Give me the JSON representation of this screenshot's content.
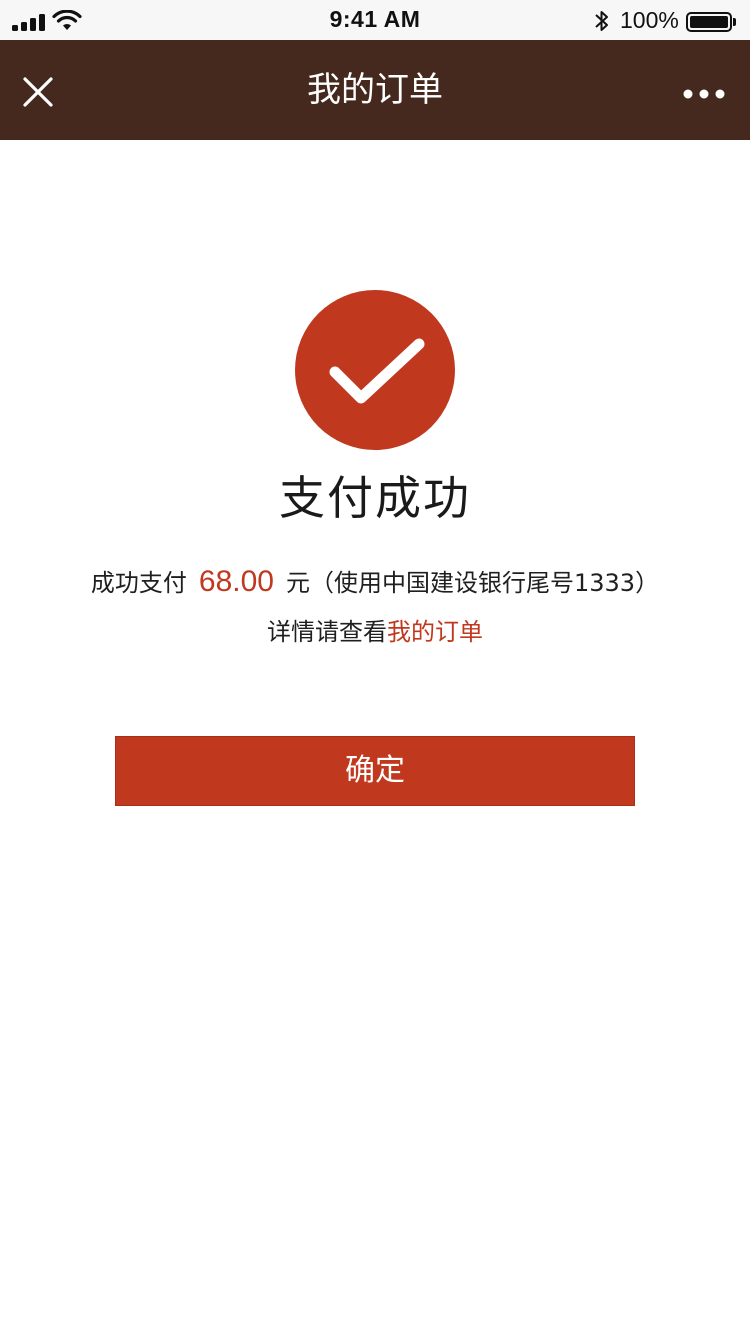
{
  "status_bar": {
    "time": "9:41 AM",
    "battery_percent": "100%",
    "battery_level": 1.0,
    "icons": [
      "signal-icon",
      "wifi-icon",
      "bluetooth-icon",
      "battery-icon"
    ]
  },
  "nav": {
    "title": "我的订单",
    "close_icon": "close-icon",
    "more_icon": "more-icon"
  },
  "result": {
    "icon": "check-circle-icon",
    "title": "支付成功",
    "pay_prefix": "成功支付",
    "amount": "68.00",
    "pay_suffix": "元（使用中国建设银行尾号1333）",
    "detail_prefix": "详情请查看",
    "detail_link": "我的订单"
  },
  "actions": {
    "confirm_label": "确定"
  },
  "colors": {
    "nav_background": "#45291e",
    "accent": "#c0391f",
    "status_bar_background": "#f7f7f7",
    "page_background": "#ffffff"
  }
}
